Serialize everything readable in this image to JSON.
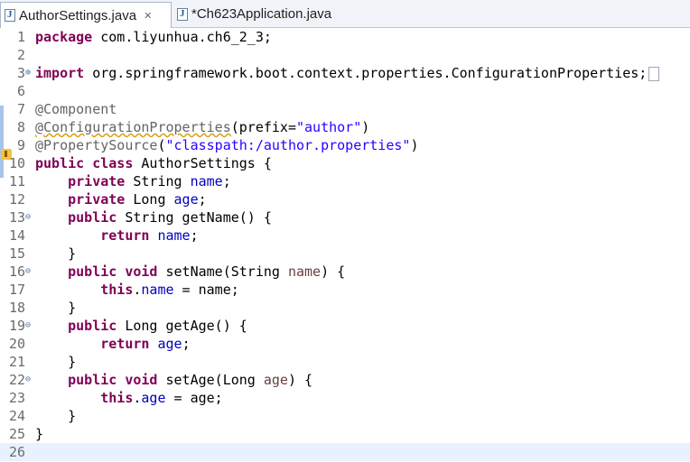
{
  "tabs": [
    {
      "label": "AuthorSettings.java",
      "icon": "java-file-icon",
      "active": true,
      "close": "✕"
    },
    {
      "label": "*Ch623Application.java",
      "icon": "java-file-icon",
      "active": false
    }
  ],
  "editor": {
    "lines": [
      {
        "n": "1"
      },
      {
        "n": "2"
      },
      {
        "n": "3",
        "fold": "⊕"
      },
      {
        "n": "6"
      },
      {
        "n": "7"
      },
      {
        "n": "8"
      },
      {
        "n": "9"
      },
      {
        "n": "10"
      },
      {
        "n": "11"
      },
      {
        "n": "12"
      },
      {
        "n": "13",
        "fold": "⊖"
      },
      {
        "n": "14"
      },
      {
        "n": "15"
      },
      {
        "n": "16",
        "fold": "⊖"
      },
      {
        "n": "17"
      },
      {
        "n": "18"
      },
      {
        "n": "19",
        "fold": "⊖"
      },
      {
        "n": "20"
      },
      {
        "n": "21"
      },
      {
        "n": "22",
        "fold": "⊖"
      },
      {
        "n": "23"
      },
      {
        "n": "24"
      },
      {
        "n": "25"
      },
      {
        "n": "26"
      }
    ],
    "tokens": {
      "package_kw": "package",
      "package_name": " com.liyunhua.ch6_2_3;",
      "import_kw": "import",
      "import_name": " org.springframework.boot.context.properties.ConfigurationProperties;",
      "component_ann": "@Component",
      "config_ann": "@ConfigurationProperties",
      "config_rest_a": "(prefix=",
      "config_str": "\"author\"",
      "config_rest_b": ")",
      "propsrc_ann": "@PropertySource",
      "propsrc_open": "(",
      "propsrc_str": "\"classpath:/author.properties\"",
      "propsrc_close": ")",
      "public": "public",
      "class": "class",
      "class_rest": " AuthorSettings {",
      "private": "private",
      "string_t": " String ",
      "long_t": " Long ",
      "name": "name",
      "age": "age",
      "semi": ";",
      "void": "void",
      "return": "return",
      "this": "this",
      "getName": " String getName() {",
      "setName_a": " setName(String ",
      "setName_b": ") {",
      "getAge": " Long getAge() {",
      "setAge_a": " setAge(Long ",
      "setAge_b": ") {",
      "assign_name": " = name;",
      "assign_age": " = age;",
      "dot": ".",
      "rbrace": "}"
    }
  },
  "colors": {
    "keyword": "#7f0055",
    "field": "#0000c0",
    "annotation": "#646464",
    "string": "#2a00ff",
    "current_line": "#e8f2fe"
  }
}
